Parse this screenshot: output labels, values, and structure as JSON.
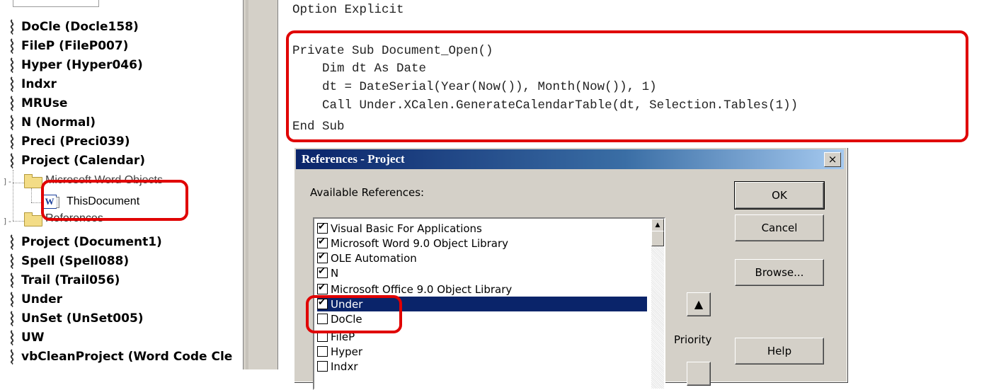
{
  "explorer": {
    "projects": [
      {
        "label": "DoCle (Docle158)"
      },
      {
        "label": "FileP (FileP007)"
      },
      {
        "label": "Hyper (Hyper046)"
      },
      {
        "label": "Indxr"
      },
      {
        "label": "MRUse"
      },
      {
        "label": "N (Normal)"
      },
      {
        "label": "Preci (Preci039)"
      },
      {
        "label": "Project (Calendar)"
      }
    ],
    "word_objects_folder": "Microsoft Word Objects",
    "this_document": "ThisDocument",
    "references_folder": "References",
    "projects_after": [
      {
        "label": "Project (Document1)"
      },
      {
        "label": "Spell (Spell088)"
      },
      {
        "label": "Trail (Trail056)"
      },
      {
        "label": "Under"
      },
      {
        "label": "UnSet (UnSet005)"
      },
      {
        "label": "UW"
      },
      {
        "label": "vbCleanProject (Word Code Cle"
      }
    ]
  },
  "code": {
    "lines": [
      "Option Explicit",
      "Private Sub Document_Open()",
      "    Dim dt As Date",
      "    dt = DateSerial(Year(Now()), Month(Now()), 1)",
      "    Call Under.XCalen.GenerateCalendarTable(dt, Selection.Tables(1))",
      "End Sub"
    ]
  },
  "dialog": {
    "title": "References - Project",
    "close": "×",
    "available_label": "Available References:",
    "priority_label": "Priority",
    "buttons": {
      "ok": "OK",
      "cancel": "Cancel",
      "browse": "Browse...",
      "help": "Help"
    },
    "priority_up": "▲",
    "references": [
      {
        "label": "Visual Basic For Applications",
        "checked": true
      },
      {
        "label": "Microsoft Word 9.0 Object Library",
        "checked": true
      },
      {
        "label": "OLE Automation",
        "checked": true
      },
      {
        "label": "N",
        "checked": true
      },
      {
        "label": "Microsoft Office 9.0 Object Library",
        "checked": true
      },
      {
        "label": "Under",
        "checked": true,
        "selected": true
      },
      {
        "label": "DoCle",
        "checked": false
      },
      {
        "label": "FileP",
        "checked": false
      },
      {
        "label": "Hyper",
        "checked": false
      },
      {
        "label": "Indxr",
        "checked": false
      }
    ]
  },
  "colors": {
    "annotation": "#e00000",
    "titlebar_start": "#0a246a",
    "titlebar_end": "#a6caf0",
    "selection": "#0a246a",
    "dialog_face": "#d4d0c8"
  }
}
